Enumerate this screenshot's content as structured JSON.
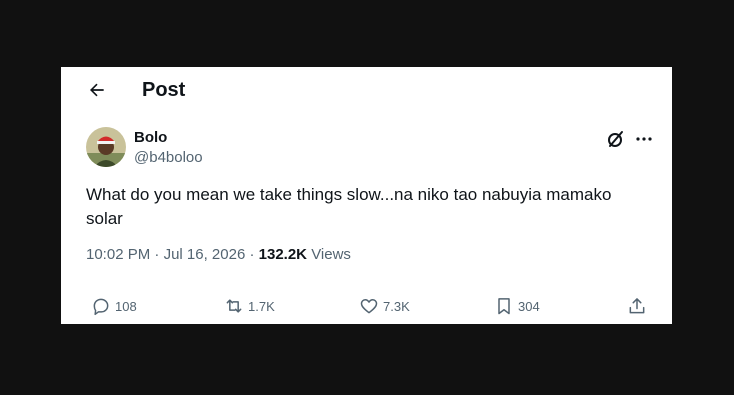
{
  "header": {
    "back_icon": "arrow-left-icon",
    "title": "Post"
  },
  "author": {
    "name": "Bolo",
    "handle": "@b4boloo"
  },
  "tweet": {
    "text": "What do you mean we take things slow...na niko tao nabuyia mamako solar",
    "time": "10:02 PM",
    "date": "Jul 16, 2026",
    "views_count": "132.2K",
    "views_label": "Views"
  },
  "actions": {
    "replies": "108",
    "reposts": "1.7K",
    "likes": "7.3K",
    "bookmarks": "304"
  },
  "icons": {
    "grok": "grok-icon",
    "more": "more-dots-icon",
    "reply": "reply-icon",
    "repost": "repost-icon",
    "like": "heart-icon",
    "bookmark": "bookmark-icon",
    "share": "share-icon"
  },
  "colors": {
    "text": "#0f1419",
    "muted": "#536471",
    "background": "#ffffff"
  }
}
